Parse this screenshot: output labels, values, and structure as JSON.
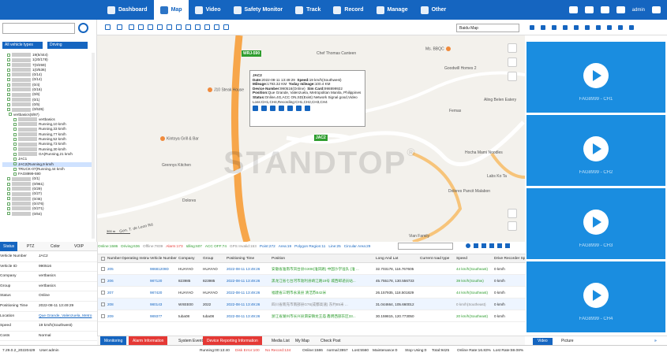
{
  "nav": {
    "items": [
      "Dashboard",
      "Map",
      "Video",
      "Safety Monitor",
      "Track",
      "Record",
      "Manage",
      "Other"
    ],
    "active_index": 1,
    "user": "admin"
  },
  "left_panel": {
    "filter_all": "All vehicle types",
    "filter_driving": "Driving",
    "tree_rows": [
      {
        "text": "19(5/444)",
        "blur": true
      },
      {
        "text": "1(20/178)",
        "blur": true
      },
      {
        "text": "7(0/259)",
        "blur": true
      },
      {
        "text": "1(0/536)",
        "blur": true
      },
      {
        "text": "(0/14)",
        "blur": true
      },
      {
        "text": "(0/14)",
        "blur": true
      },
      {
        "text": "(0/4)",
        "blur": true
      },
      {
        "text": "(0/16)",
        "blur": true
      },
      {
        "text": "(0/6)",
        "blur": true
      },
      {
        "text": "(0/1)",
        "blur": true
      },
      {
        "text": "(0/5)",
        "blur": true
      },
      {
        "text": "(0/535)",
        "blur": true
      },
      {
        "text": "vertbasics(8/97)",
        "blur": false
      },
      {
        "text": "vertbasics",
        "blur": true
      },
      {
        "text": "Running,10 km/h",
        "blur": true
      },
      {
        "text": "Running,33 km/h",
        "blur": true
      },
      {
        "text": "Running,77 km/h",
        "blur": true
      },
      {
        "text": "Running,52 km/h",
        "blur": true
      },
      {
        "text": "Running,73 km/h",
        "blur": true
      },
      {
        "text": "Running,30 km/h",
        "blur": true
      },
      {
        "text": "GA(Running,21 km/h",
        "blur": true
      },
      {
        "text": "JAC1",
        "blur": false
      },
      {
        "text": "JAC2(Running,9 km/h",
        "blur": false,
        "highlight": true
      },
      {
        "text": "TRUCK-07(Running,44 km/h",
        "blur": false
      },
      {
        "text": "FAG8999-590",
        "blur": false
      },
      {
        "text": "(0/1)",
        "blur": true
      },
      {
        "text": "(0/961)",
        "blur": true
      },
      {
        "text": "(0/29)",
        "blur": true
      },
      {
        "text": "(0/27)",
        "blur": true
      },
      {
        "text": "(0/45)",
        "blur": true
      },
      {
        "text": "(0/476)",
        "blur": true
      },
      {
        "text": "(0/271)",
        "blur": true
      },
      {
        "text": "(0/64)",
        "blur": true
      }
    ]
  },
  "info_tabs": [
    "Status",
    "PTZ",
    "Color",
    "VOIP"
  ],
  "info": [
    {
      "k": "Vehicle Number",
      "v": "JAC2"
    },
    {
      "k": "Vehicle ID",
      "v": "990516"
    },
    {
      "k": "Company",
      "v": "vertbasics"
    },
    {
      "k": "Group",
      "v": "vertbasics"
    },
    {
      "k": "Status",
      "v": "Online"
    },
    {
      "k": "Positioning Time",
      "v": "2022-08-11 13:49:29"
    },
    {
      "k": "Location",
      "v": "Que Grande, Valenzuela, Metro",
      "link": true
    },
    {
      "k": "Speed",
      "v": "19 km/h(Southwest)"
    },
    {
      "k": "Costs",
      "v": "Normal"
    }
  ],
  "map": {
    "map_type": "Baidu Map",
    "popup": {
      "title": "JAC2",
      "date_label": "Date:",
      "date": "2022-08-11 13:49:29",
      "speed_label": "Speed:",
      "speed": "19 km/h(Southwest)",
      "mileage_label": "Mileage:",
      "mileage": "1793.32 KM",
      "today_label": "Today mileage:",
      "today": "100.4 KM",
      "device_label": "Device Number:",
      "device": "990516(Online)",
      "sim_label": "Sim Card:",
      "sim": "998899922",
      "position_label": "Position:",
      "position": "Que Grande, Valenzuela, Metropolitan Manila, Philippines",
      "status_label": "Status:",
      "status": "Online,4G,ACC ON,SD(Exist) Network Signal good,Video Loss:CH1,CH4,Recording:CH1,CH2,CH3,CH4"
    },
    "car_tags": [
      "WRJ-590",
      "JAC2"
    ],
    "pois": [
      "J10 Steak House",
      "Kintoya Grill & Bar",
      "Grennys Kitchen",
      "Chef Thomas Canteen",
      "Ms. BBQC",
      "Goodwill Homes 2",
      "Aling Belen Eatery",
      "Femas",
      "Hocha Mami Noodles",
      "Labs Ko Ta",
      "Dolores Pancit Malabon",
      "Vian Family",
      "Dolores"
    ],
    "road_label": "Gen. T. de Leon Rd",
    "scale": "300 m",
    "watermark": "STANDTOP",
    "watermark_mark": "®"
  },
  "grid": {
    "stats": [
      {
        "label": "Online:1586",
        "color": "#2e9d2e"
      },
      {
        "label": "Driving:636",
        "color": "#2e9d2e"
      },
      {
        "label": "Offline:7839",
        "color": "#888888"
      },
      {
        "label": "Alarm:173",
        "color": "#e53935"
      },
      {
        "label": "Idling:607",
        "color": "#2e9d2e"
      },
      {
        "label": "ACC OFF:74",
        "color": "#2e9d2e"
      },
      {
        "label": "GPS Invalid:153",
        "color": "#888888"
      },
      {
        "label": "Point:272",
        "color": "#1565c0"
      },
      {
        "label": "Area:19",
        "color": "#1565c0"
      },
      {
        "label": "Polygon Region:11",
        "color": "#1565c0"
      },
      {
        "label": "Line:25",
        "color": "#1565c0"
      },
      {
        "label": "Circular Area:29",
        "color": "#1565c0"
      }
    ],
    "headers": [
      "Number",
      "Operating Instruction",
      "Vehicle Number",
      "Company",
      "Group",
      "Positioning Time",
      "Position",
      "Long And Lat",
      "Current road type",
      "Speed",
      "Drive Recorder Speed"
    ],
    "rows": [
      {
        "num": "205",
        "veh": "98681209D",
        "co": "HUAYAO",
        "grp": "HUAYAO",
        "time": "2022-08-11 13:49:26",
        "pos": "安徽省淮南市凤台县G308(淮凤路) 中国沙学准队 (淮 ...",
        "ll": "32.703178, 116.767605",
        "speed": "44 km/h(Southeast)",
        "rec": "0 km/h",
        "color": "green"
      },
      {
        "num": "206",
        "veh": "987120",
        "co": "823985",
        "grp": "823985",
        "time": "2022-08-11 13:49:26",
        "pos": "黑龙江省七台河市勃利县靖江路19号 城西邮递员站...",
        "ll": "45.755178, 130.556733",
        "speed": "39 km/h(Southw)",
        "rec": "0 km/h",
        "color": "green"
      },
      {
        "num": "207",
        "veh": "987420",
        "co": "HUAYAO",
        "grp": "HUAYAO",
        "time": "2022-08-11 13:49:26",
        "pos": "福建省三明市永溪县 清洁苏B42米",
        "ll": "26.157935, 118.501829",
        "speed": "44 km/h(Southeast)",
        "rec": "0 km/h",
        "color": "green"
      },
      {
        "num": "208",
        "veh": "980143",
        "co": "WXEE00",
        "grp": "2022",
        "time": "2022-08-11 13:49:26",
        "pos": "四川省南充市南部县G76(成都高速) 东约85米 ...",
        "ll": "31.044664, 105.660012",
        "speed": "0 km/h(Southeast)",
        "rec": "0 km/h",
        "color": "gray"
      },
      {
        "num": "209",
        "veh": "989377",
        "co": "tuba08",
        "grp": "tuba08",
        "time": "2022-08-11 13:49:26",
        "pos": "浙江省湖州市长兴县泗安镇龙王庙 鑫明西部东区33...",
        "ll": "30.159815, 120.773050",
        "speed": "20 km/h(Southeast)",
        "rec": "0 km/h",
        "color": "green"
      }
    ]
  },
  "bottom_tabs": [
    "Monitoring",
    "Alarm Information",
    "System Event",
    "Device Reporting Information",
    "Media List",
    "My Map",
    "Check Post"
  ],
  "video": {
    "channels": [
      "FAG8999 - CH1",
      "FAG8999 - CH2",
      "FAG8999 - CH3",
      "FAG8999 - CH4"
    ],
    "tab_video": "Video",
    "tab_picture": "Picture"
  },
  "footer": {
    "version": "7.29.0.2_20220429",
    "user": "User:admin",
    "running": "Running:00:13:40",
    "disk_error": "Disk Error:100",
    "no_record": "No Record:134",
    "online": "Online:1586",
    "normal": "normal:3957",
    "lost": "Lost:5560",
    "maintenance": "Maintenance:0",
    "stop_using": "Stop Using:0",
    "total": "Total:9425",
    "online_rate": "Online Rate:16.83%",
    "lost_rate": "Lost Rate:59.08%"
  },
  "colors": {
    "brand": "#1565c0",
    "alarm": "#e53935",
    "online": "#2e9d2e",
    "video": "#1a8de0"
  }
}
